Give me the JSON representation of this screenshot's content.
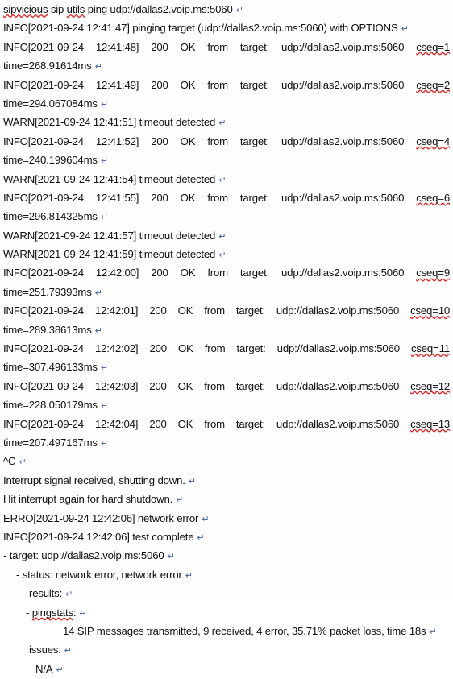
{
  "document": {
    "type": "word-processor-document",
    "background_color": "#fefefe",
    "text_color": "#101010",
    "spellcheck_underline_color": "#e02020",
    "paragraph_mark": "↵",
    "paragraph_mark_color": "#3b5ea8"
  },
  "command": {
    "text": "sipvicious sip utils ping udp://dallas2.voip.ms:5060",
    "misspelled_words": [
      "sipvicious",
      "utils"
    ]
  },
  "log": {
    "target": "udp://dallas2.voip.ms:5060",
    "lines": [
      {
        "id": "l01",
        "kind": "command",
        "text": "sipvicious sip utils ping udp://dallas2.voip.ms:5060"
      },
      {
        "id": "l02",
        "kind": "info-plain",
        "text": "INFO[2021-09-24 12:41:47] pinging target (udp://dallas2.voip.ms:5060) with OPTIONS"
      },
      {
        "id": "l03",
        "kind": "info-justified",
        "level": "INFO",
        "stamp": "[2021-09-24",
        "time": "12:41:48]",
        "code": "200",
        "status": "OK",
        "from": "from",
        "target_label": "target:",
        "target": "udp://dallas2.voip.ms:5060",
        "cseq": "cseq=1"
      },
      {
        "id": "l04",
        "kind": "time",
        "text": "time=268.91614ms"
      },
      {
        "id": "l05",
        "kind": "info-justified",
        "level": "INFO",
        "stamp": "[2021-09-24",
        "time": "12:41:49]",
        "code": "200",
        "status": "OK",
        "from": "from",
        "target_label": "target:",
        "target": "udp://dallas2.voip.ms:5060",
        "cseq": "cseq=2"
      },
      {
        "id": "l06",
        "kind": "time",
        "text": "time=294.067084ms"
      },
      {
        "id": "l07",
        "kind": "warn",
        "text": "WARN[2021-09-24 12:41:51] timeout detected"
      },
      {
        "id": "l08",
        "kind": "info-justified",
        "level": "INFO",
        "stamp": "[2021-09-24",
        "time": "12:41:52]",
        "code": "200",
        "status": "OK",
        "from": "from",
        "target_label": "target:",
        "target": "udp://dallas2.voip.ms:5060",
        "cseq": "cseq=4"
      },
      {
        "id": "l09",
        "kind": "time",
        "text": "time=240.199604ms"
      },
      {
        "id": "l10",
        "kind": "warn",
        "text": "WARN[2021-09-24 12:41:54] timeout detected"
      },
      {
        "id": "l11",
        "kind": "info-justified",
        "level": "INFO",
        "stamp": "[2021-09-24",
        "time": "12:41:55]",
        "code": "200",
        "status": "OK",
        "from": "from",
        "target_label": "target:",
        "target": "udp://dallas2.voip.ms:5060",
        "cseq": "cseq=6"
      },
      {
        "id": "l12",
        "kind": "time",
        "text": "time=296.814325ms"
      },
      {
        "id": "l13",
        "kind": "warn",
        "text": "WARN[2021-09-24 12:41:57] timeout detected"
      },
      {
        "id": "l14",
        "kind": "warn",
        "text": "WARN[2021-09-24 12:41:59] timeout detected"
      },
      {
        "id": "l15",
        "kind": "info-justified",
        "level": "INFO",
        "stamp": "[2021-09-24",
        "time": "12:42:00]",
        "code": "200",
        "status": "OK",
        "from": "from",
        "target_label": "target:",
        "target": "udp://dallas2.voip.ms:5060",
        "cseq": "cseq=9"
      },
      {
        "id": "l16",
        "kind": "time",
        "text": "time=251.79393ms"
      },
      {
        "id": "l17",
        "kind": "info-justified",
        "level": "INFO",
        "stamp": "[2021-09-24",
        "time": "12:42:01]",
        "code": "200",
        "status": "OK",
        "from": "from",
        "target_label": "target:",
        "target": "udp://dallas2.voip.ms:5060",
        "cseq": "cseq=10"
      },
      {
        "id": "l18",
        "kind": "time",
        "text": "time=289.38613ms"
      },
      {
        "id": "l19",
        "kind": "info-justified",
        "level": "INFO",
        "stamp": "[2021-09-24",
        "time": "12:42:02]",
        "code": "200",
        "status": "OK",
        "from": "from",
        "target_label": "target:",
        "target": "udp://dallas2.voip.ms:5060",
        "cseq": "cseq=11"
      },
      {
        "id": "l20",
        "kind": "time",
        "text": "time=307.496133ms"
      },
      {
        "id": "l21",
        "kind": "info-justified",
        "level": "INFO",
        "stamp": "[2021-09-24",
        "time": "12:42:03]",
        "code": "200",
        "status": "OK",
        "from": "from",
        "target_label": "target:",
        "target": "udp://dallas2.voip.ms:5060",
        "cseq": "cseq=12"
      },
      {
        "id": "l22",
        "kind": "time",
        "text": "time=228.050179ms"
      },
      {
        "id": "l23",
        "kind": "info-justified",
        "level": "INFO",
        "stamp": "[2021-09-24",
        "time": "12:42:04]",
        "code": "200",
        "status": "OK",
        "from": "from",
        "target_label": "target:",
        "target": "udp://dallas2.voip.ms:5060",
        "cseq": "cseq=13"
      },
      {
        "id": "l24",
        "kind": "time",
        "text": "time=207.497167ms"
      },
      {
        "id": "l25",
        "kind": "interrupt",
        "text": "^C"
      },
      {
        "id": "l26",
        "kind": "plain",
        "text": "Interrupt signal received, shutting down."
      },
      {
        "id": "l27",
        "kind": "plain",
        "text": "Hit interrupt again for hard shutdown."
      },
      {
        "id": "l28",
        "kind": "error",
        "text": "ERRO[2021-09-24 12:42:06] network error"
      },
      {
        "id": "l29",
        "kind": "info-plain",
        "text": "INFO[2021-09-24 12:42:06] test complete"
      },
      {
        "id": "l30",
        "kind": "summary-0",
        "text": "- target: udp://dallas2.voip.ms:5060"
      },
      {
        "id": "l31",
        "kind": "summary-1",
        "text": "- status: network error, network error"
      },
      {
        "id": "l32",
        "kind": "summary-2",
        "text": "results:"
      },
      {
        "id": "l33",
        "kind": "summary-3",
        "text": "- pingstats:",
        "misspelled_words": [
          "pingstats"
        ]
      },
      {
        "id": "l34",
        "kind": "summary-4",
        "text": "14 SIP messages transmitted, 9 received, 4 error, 35.71% packet loss, time 18s"
      },
      {
        "id": "l35",
        "kind": "summary-2",
        "text": "issues:"
      },
      {
        "id": "l36",
        "kind": "summary-5",
        "text": "N/A"
      }
    ]
  },
  "summary_stats": {
    "target": "udp://dallas2.voip.ms:5060",
    "status": "network error, network error",
    "messages_transmitted": 14,
    "received": 9,
    "error": 4,
    "packet_loss": "35.71%",
    "elapsed_time": "18s",
    "issues": "N/A"
  },
  "line_texts": {
    "l01a": "sipvicious",
    "l01b": " sip ",
    "l01c": "utils",
    "l01d": " ping udp://dallas2.voip.ms:5060",
    "l02": "INFO[2021-09-24 12:41:47] pinging target (udp://dallas2.voip.ms:5060) with OPTIONS",
    "l04": "time=268.91614ms",
    "l06": "time=294.067084ms",
    "l07": "WARN[2021-09-24 12:41:51] timeout detected",
    "l09": "time=240.199604ms",
    "l10": "WARN[2021-09-24 12:41:54] timeout detected",
    "l12": "time=296.814325ms",
    "l13": "WARN[2021-09-24 12:41:57] timeout detected",
    "l14": "WARN[2021-09-24 12:41:59] timeout detected",
    "l16": "time=251.79393ms",
    "l18": "time=289.38613ms",
    "l20": "time=307.496133ms",
    "l22": "time=228.050179ms",
    "l24": "time=207.497167ms",
    "l25": "^C",
    "l26": "Interrupt signal received, shutting down.",
    "l27": "Hit interrupt again for hard shutdown.",
    "l28": "ERRO[2021-09-24 12:42:06] network error",
    "l29": "INFO[2021-09-24 12:42:06] test complete",
    "l30": "- target: udp://dallas2.voip.ms:5060",
    "l31": "- status: network error, network error",
    "l32": "results:",
    "l33a": "- ",
    "l33b": "pingstats",
    "l33c": ":",
    "l34": "14 SIP messages transmitted, 9 received, 4 error, 35.71% packet loss, time 18s",
    "l35": "issues:",
    "l36": "N/A"
  },
  "tokens": {
    "level_info": "INFO",
    "stamp": "[2021-09-24",
    "code": "200",
    "status_ok": "OK",
    "from": "from",
    "target_label": "target:",
    "target": "udp://dallas2.voip.ms:5060",
    "t03": "12:41:48]",
    "c03": "cseq=1",
    "t05": "12:41:49]",
    "c05": "cseq=2",
    "t08": "12:41:52]",
    "c08": "cseq=4",
    "t11": "12:41:55]",
    "c11": "cseq=6",
    "t15": "12:42:00]",
    "c15": "cseq=9",
    "t17": "12:42:01]",
    "c17": "cseq=10",
    "t19": "12:42:02]",
    "c19": "cseq=11",
    "t21": "12:42:03]",
    "c21": "cseq=12",
    "t23": "12:42:04]",
    "c23": "cseq=13"
  },
  "marks": {
    "pilcrow": "↵"
  }
}
